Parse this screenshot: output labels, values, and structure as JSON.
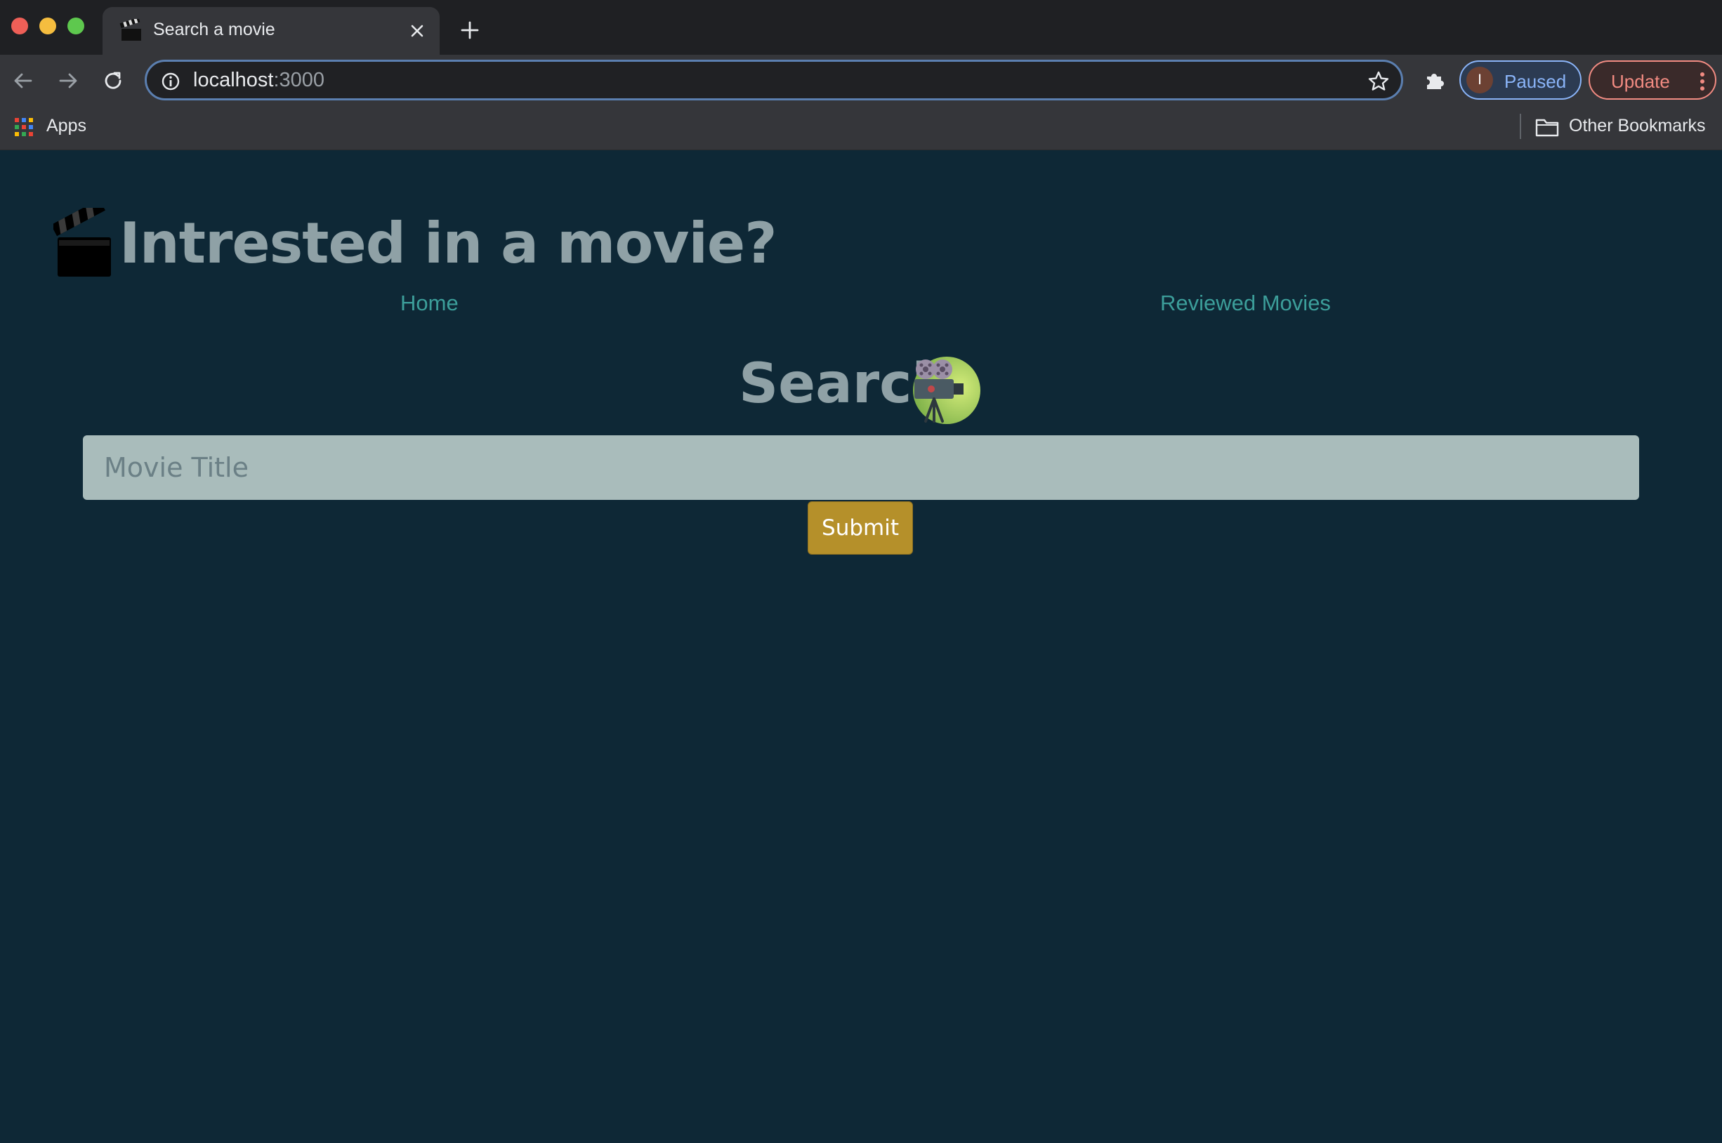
{
  "browser": {
    "tab": {
      "title": "Search a movie"
    },
    "address": {
      "host": "localhost",
      "port": ":3000"
    },
    "profile": {
      "initial": "I",
      "label": "Paused"
    },
    "update": {
      "label": "Update"
    },
    "bookmarks": {
      "apps_label": "Apps",
      "other_label": "Other Bookmarks"
    },
    "colors": {
      "tabbar": "#1f2023",
      "toolbar": "#35363a",
      "omnibox_border": "#5b7fb0",
      "profile_accent": "#8ab4f8",
      "update_accent": "#f28b82"
    }
  },
  "page": {
    "title": "Intrested in a movie?",
    "nav": {
      "home": "Home",
      "reviewed": "Reviewed Movies"
    },
    "search": {
      "heading": "Search",
      "placeholder": "Movie Title",
      "value": "",
      "submit_label": "Submit"
    },
    "icons": {
      "title_icon": "clapperboard-icon",
      "search_icon": "movie-projector-icon"
    },
    "colors": {
      "background": "#0e2836",
      "heading": "#8fa1a6",
      "link": "#3c9e9a",
      "input_bg": "#a9bcbb",
      "button_bg": "#b5902a"
    }
  }
}
